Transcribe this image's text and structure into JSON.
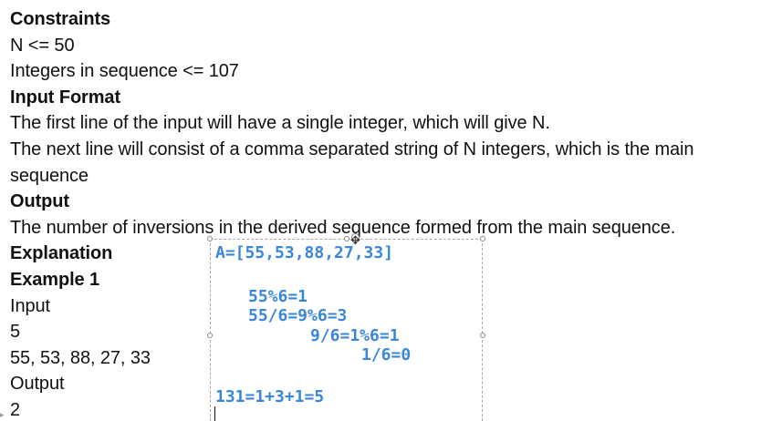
{
  "document": {
    "lines": [
      {
        "text": "Constraints",
        "bold": true
      },
      {
        "text": "N <= 50",
        "bold": false
      },
      {
        "text": "Integers in sequence <= 107",
        "bold": false
      },
      {
        "text": "Input Format",
        "bold": true
      },
      {
        "text": "The first line of the input will have a single integer, which will give N.",
        "bold": false
      },
      {
        "text": "The next line will consist of a comma separated string of N integers, which is the main",
        "bold": false
      },
      {
        "text": "sequence",
        "bold": false
      },
      {
        "text": "Output",
        "bold": true
      },
      {
        "text": "The number of inversions in the derived sequence formed from the main sequence.",
        "bold": false
      },
      {
        "text": "Explanation",
        "bold": true
      },
      {
        "text": "Example 1",
        "bold": true
      },
      {
        "text": "Input",
        "bold": false
      },
      {
        "text": "5",
        "bold": false
      },
      {
        "text": "55, 53, 88, 27, 33",
        "bold": false
      },
      {
        "text": "Output",
        "bold": false
      },
      {
        "text": "2",
        "bold": false
      }
    ]
  },
  "annotation": {
    "array_line": "A=[55,53,88,27,33]",
    "step1": "55%6=1",
    "step2": "55/6=9%6=3",
    "step3": "9/6=1%6=1",
    "step4": "1/6=0",
    "result": "131=1+3+1=5",
    "text_color": "#3a86d8"
  }
}
